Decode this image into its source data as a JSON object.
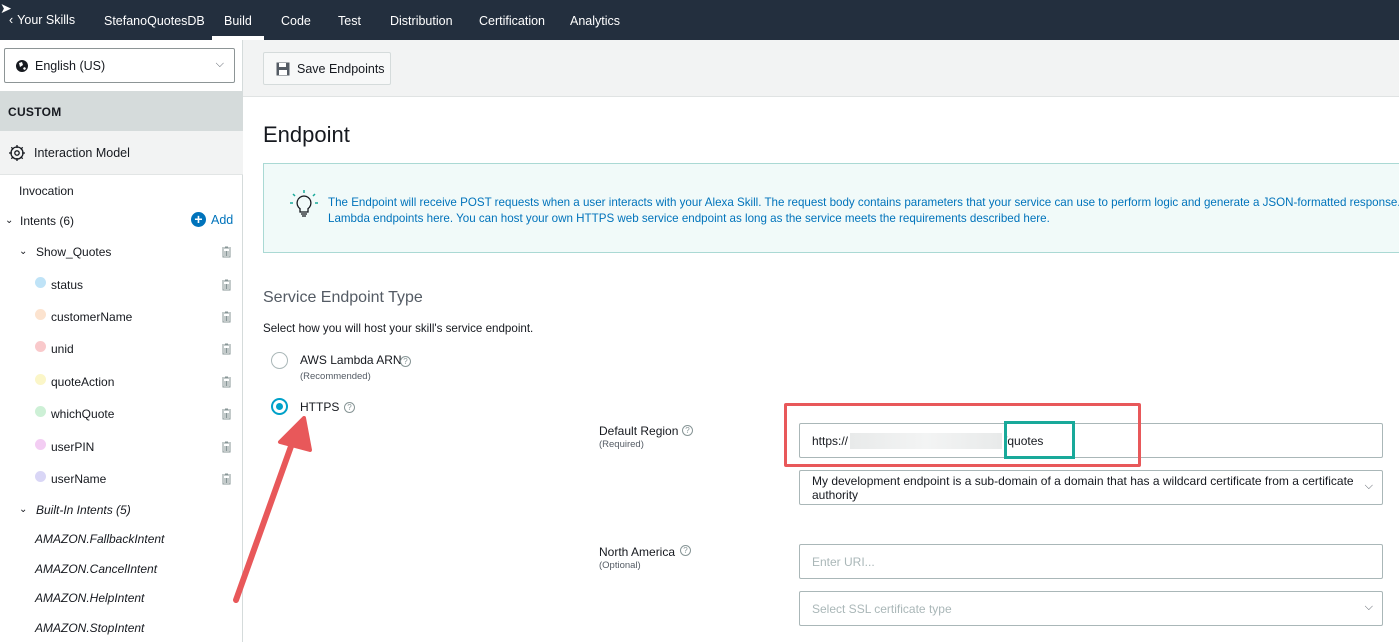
{
  "topnav": {
    "back_label": "Your Skills",
    "tabs": [
      "StefanoQuotesDB",
      "Build",
      "Code",
      "Test",
      "Distribution",
      "Certification",
      "Analytics"
    ],
    "active_tab": "Build"
  },
  "sidebar": {
    "locale": "English (US)",
    "section_title": "CUSTOM",
    "interaction_model": "Interaction Model",
    "invocation": "Invocation",
    "intents_label": "Intents (6)",
    "add_label": "Add",
    "intent_name": "Show_Quotes",
    "slots": [
      {
        "name": "status",
        "color": "#bfe3f7"
      },
      {
        "name": "customerName",
        "color": "#fce3cf"
      },
      {
        "name": "unid",
        "color": "#f9c9cb"
      },
      {
        "name": "quoteAction",
        "color": "#fbf6c8"
      },
      {
        "name": "whichQuote",
        "color": "#cdf0d6"
      },
      {
        "name": "userPIN",
        "color": "#f3cdf3"
      },
      {
        "name": "userName",
        "color": "#d9d6f6"
      }
    ],
    "builtin_label": "Built-In Intents (5)",
    "builtin_intents": [
      "AMAZON.FallbackIntent",
      "AMAZON.CancelIntent",
      "AMAZON.HelpIntent",
      "AMAZON.StopIntent"
    ]
  },
  "toolbar": {
    "save_label": "Save Endpoints"
  },
  "main": {
    "title": "Endpoint",
    "info_line1": "The Endpoint will receive POST requests when a user interacts with your Alexa Skill. The request body contains parameters that your service can use to perform logic and generate a JSON-formatted response. Learn more",
    "info_line2_a": "Lambda endpoints ",
    "info_link1": "here",
    "info_line2_b": ". You can host your own HTTPS web service endpoint as long as the service meets the requirements described ",
    "info_link2": "here",
    "info_line2_c": ".",
    "section_title": "Service Endpoint Type",
    "hint": "Select how you will host your skill's service endpoint.",
    "option_lambda": "AWS Lambda ARN",
    "option_lambda_sub": "(Recommended)",
    "option_https": "HTTPS",
    "default_region": "Default Region",
    "default_region_sub": "(Required)",
    "url_prefix": "https://",
    "url_suffix": "/quotes",
    "cert_select": "My development endpoint is a sub-domain of a domain that has a wildcard certificate from a certificate authority",
    "north_america": "North America",
    "north_america_sub": "(Optional)",
    "uri_placeholder": "Enter URI...",
    "ssl_placeholder": "Select SSL certificate type"
  },
  "colors": {
    "nav_bg": "#232f3e",
    "accent": "#00a1c9",
    "link": "#0073bb",
    "annotation_red": "#e8585a",
    "annotation_green": "#18a99a"
  }
}
